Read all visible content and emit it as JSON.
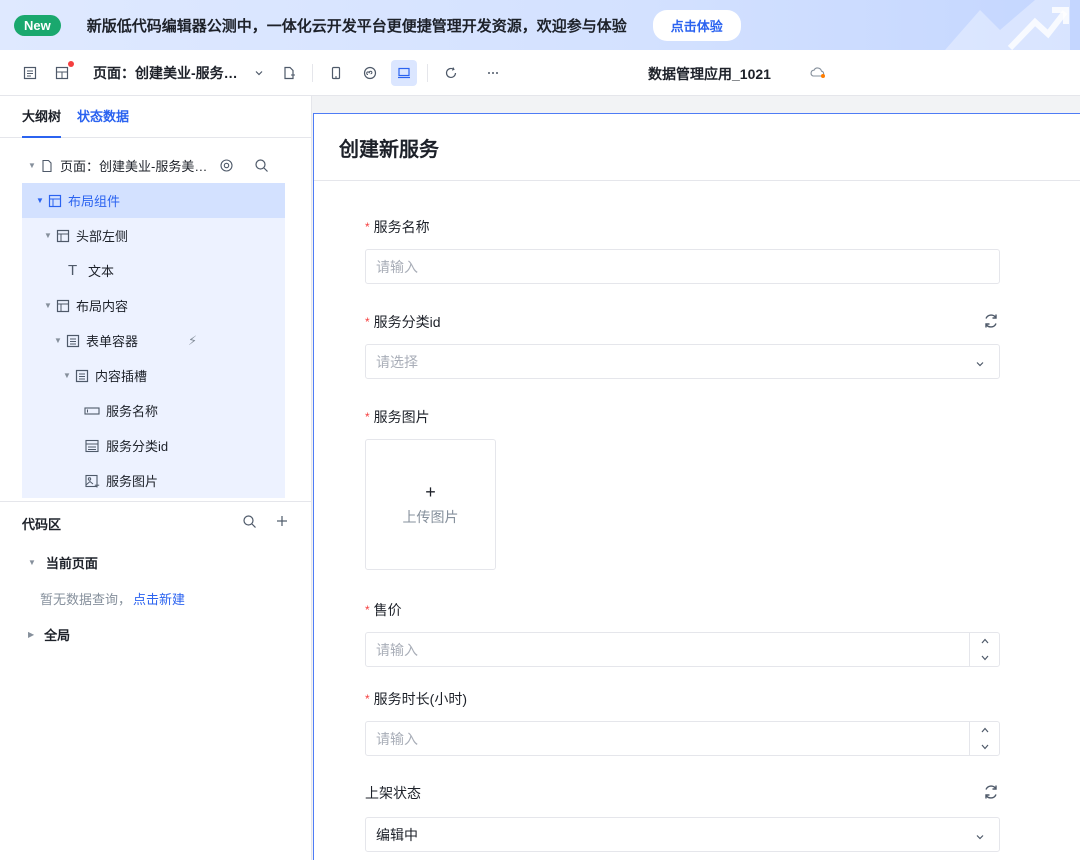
{
  "banner": {
    "badge": "New",
    "text": "新版低代码编辑器公测中，一体化云开发平台更便捷管理开发资源，欢迎参与体验",
    "button": "点击体验"
  },
  "toolbar": {
    "page_selector": "页面：创建美业-服务…",
    "app_title": "数据管理应用_1021"
  },
  "left_tabs": [
    "大纲树",
    "状态数据"
  ],
  "tree": {
    "page": "页面：创建美业-服务美…",
    "layout": "布局组件",
    "header_left": "头部左侧",
    "text": "文本",
    "layout_content": "布局内容",
    "form_container": "表单容器",
    "content_slot": "内容插槽",
    "f_name": "服务名称",
    "f_category": "服务分类id",
    "f_image": "服务图片"
  },
  "code_area": {
    "title": "代码区",
    "current_page": "当前页面",
    "empty_text": "暂无数据查询，",
    "create_link": "点击新建",
    "global": "全局"
  },
  "form": {
    "title": "创建新服务",
    "name_label": "服务名称",
    "name_placeholder": "请输入",
    "category_label": "服务分类id",
    "category_placeholder": "请选择",
    "image_label": "服务图片",
    "upload_text": "上传图片",
    "price_label": "售价",
    "price_placeholder": "请输入",
    "duration_label": "服务时长(小时)",
    "duration_placeholder": "请输入",
    "status_label": "上架状态",
    "status_value": "编辑中"
  }
}
